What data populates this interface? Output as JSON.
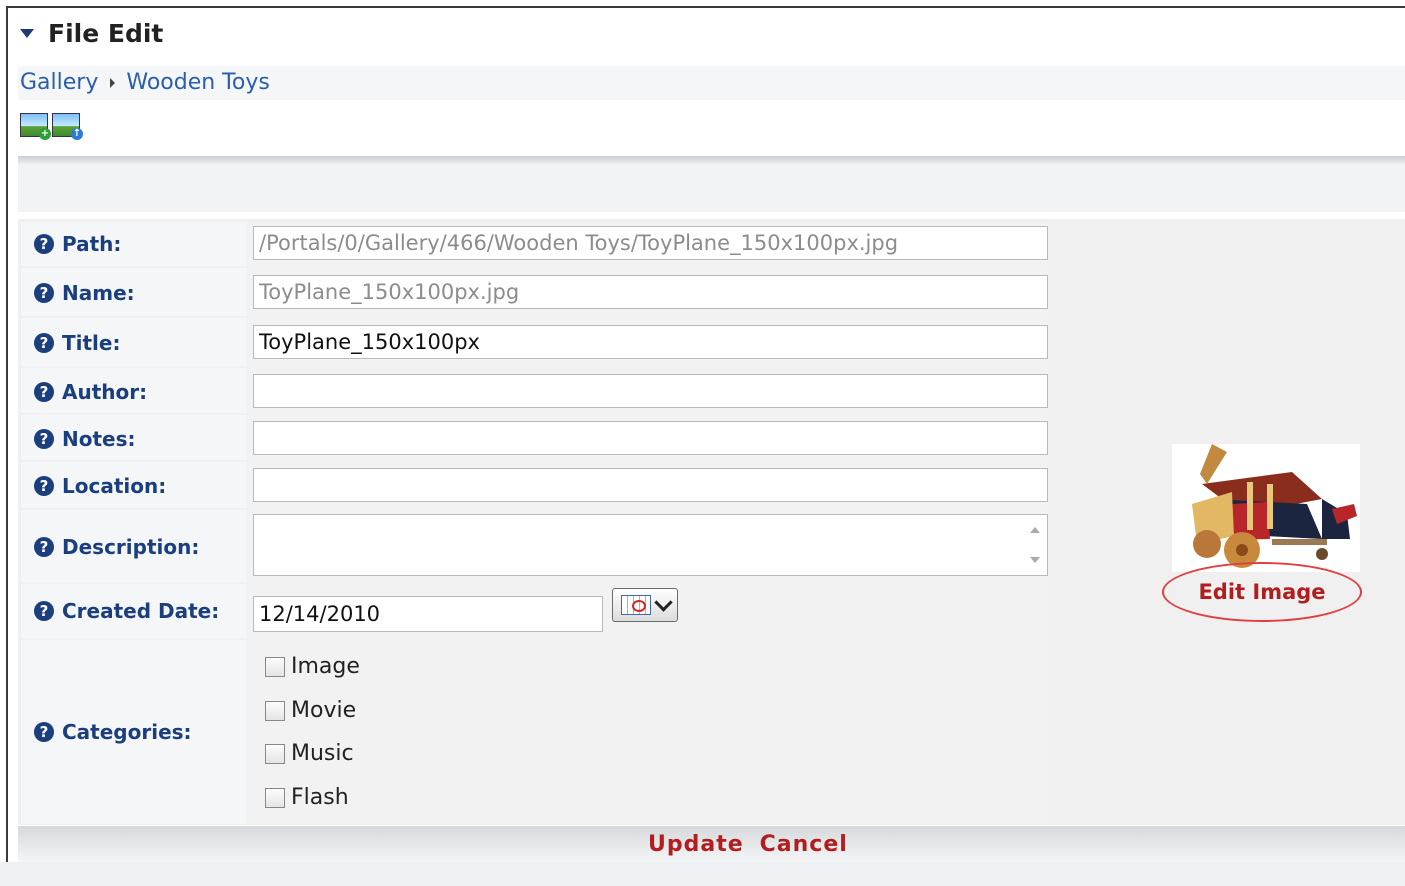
{
  "module": {
    "title": "File Edit"
  },
  "breadcrumb": [
    {
      "label": "Gallery"
    },
    {
      "label": "Wooden Toys"
    }
  ],
  "toolbar": {
    "icons": [
      "add-image-icon",
      "upload-image-icon"
    ]
  },
  "form": {
    "path": {
      "label": "Path:",
      "value": "/Portals/0/Gallery/466/Wooden Toys/ToyPlane_150x100px.jpg"
    },
    "name": {
      "label": "Name:",
      "value": "ToyPlane_150x100px.jpg"
    },
    "title": {
      "label": "Title:",
      "value": "ToyPlane_150x100px"
    },
    "author": {
      "label": "Author:",
      "value": ""
    },
    "notes": {
      "label": "Notes:",
      "value": ""
    },
    "location": {
      "label": "Location:",
      "value": ""
    },
    "description": {
      "label": "Description:",
      "value": ""
    },
    "created_date": {
      "label": "Created Date:",
      "value": "12/14/2010"
    },
    "categories": {
      "label": "Categories:",
      "options": [
        {
          "label": "Image",
          "checked": false
        },
        {
          "label": "Movie",
          "checked": false
        },
        {
          "label": "Music",
          "checked": false
        },
        {
          "label": "Flash",
          "checked": false
        }
      ]
    }
  },
  "preview": {
    "edit_label": "Edit Image"
  },
  "actions": {
    "update_label": "Update",
    "cancel_label": "Cancel"
  },
  "colors": {
    "label": "#1b3f7e",
    "link": "#2a5db0",
    "action": "#b21e1e"
  }
}
